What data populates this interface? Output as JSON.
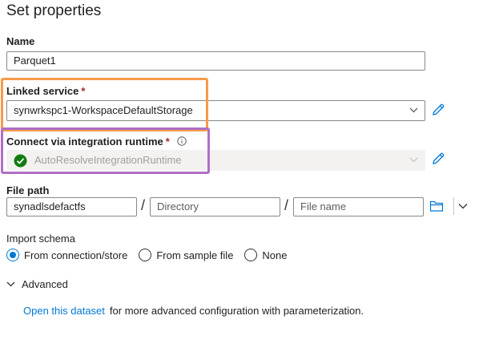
{
  "title": "Set properties",
  "name": {
    "label": "Name",
    "value": "Parquet1"
  },
  "linked_service": {
    "label": "Linked service",
    "required": "*",
    "value": "synwrkspc1-WorkspaceDefaultStorage"
  },
  "integration_runtime": {
    "label": "Connect via integration runtime",
    "required": "*",
    "value": "AutoResolveIntegrationRuntime"
  },
  "file_path": {
    "label": "File path",
    "container": "synadlsdefactfs",
    "directory_placeholder": "Directory",
    "file_placeholder": "File name",
    "separator": "/"
  },
  "import_schema": {
    "label": "Import schema",
    "options": [
      "From connection/store",
      "From sample file",
      "None"
    ],
    "selected": "From connection/store"
  },
  "advanced": {
    "label": "Advanced"
  },
  "footer": {
    "link": "Open this dataset",
    "text": "for more advanced configuration with parameterization."
  },
  "colors": {
    "accent": "#0078d4",
    "required": "#a4262c",
    "success": "#107c10",
    "highlight_linked": "#f79a4a",
    "highlight_runtime": "#b06fc6"
  }
}
